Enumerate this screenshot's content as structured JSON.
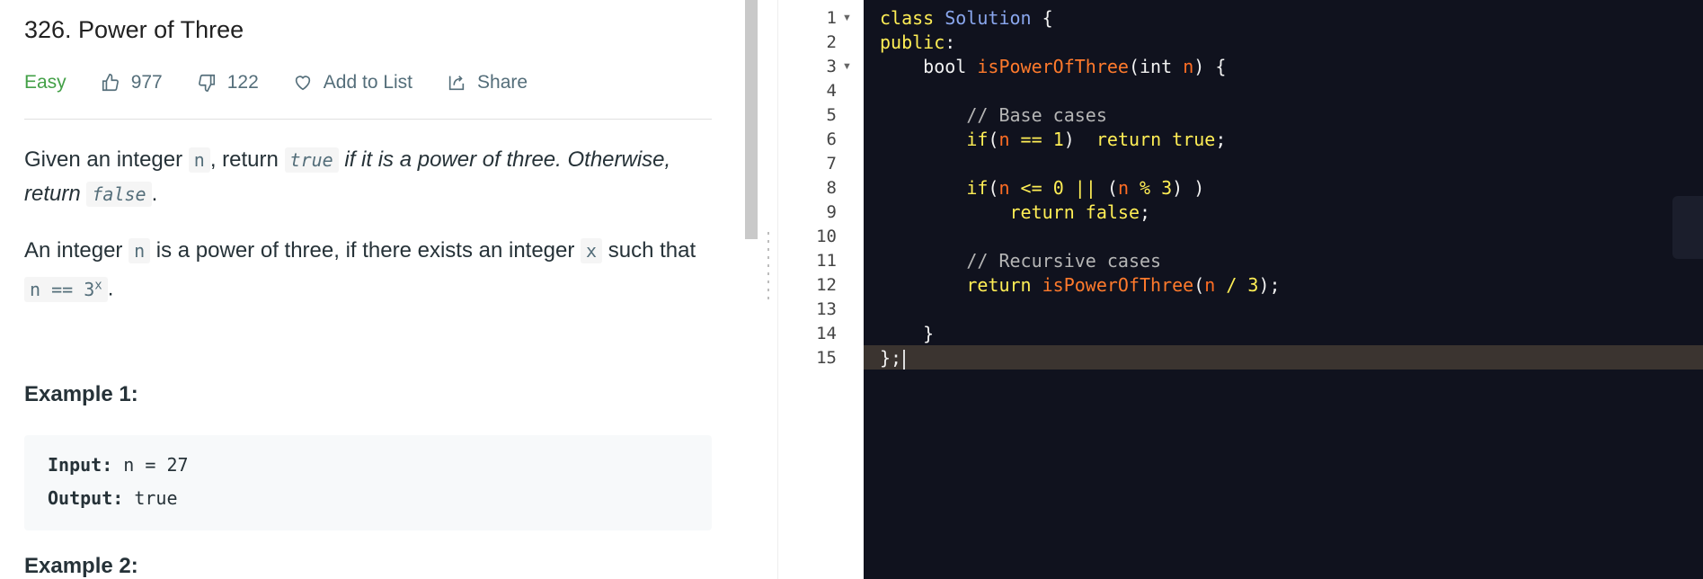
{
  "problem": {
    "title": "326. Power of Three",
    "difficulty": "Easy",
    "likes": "977",
    "dislikes": "122",
    "add_to_list": "Add to List",
    "share": "Share"
  },
  "description": {
    "p1": {
      "t1": "Given an integer ",
      "c1": "n",
      "t2": ", return ",
      "c2": "true",
      "t3": " ",
      "em1": "if it is a power of three. Otherwise, return ",
      "c3": "false",
      "t4": "."
    },
    "p2": {
      "t1": "An integer ",
      "c1": "n",
      "t2": " is a power of three, if there exists an integer ",
      "c2": "x",
      "t3": " such that ",
      "c3": "n == 3",
      "c3sup": "x",
      "t4": "."
    }
  },
  "examples": [
    {
      "heading": "Example 1:",
      "input_label": "Input:",
      "input_value": " n = 27",
      "output_label": "Output:",
      "output_value": " true"
    },
    {
      "heading": "Example 2:"
    }
  ],
  "editor": {
    "line_numbers": [
      "1",
      "2",
      "3",
      "4",
      "5",
      "6",
      "7",
      "8",
      "9",
      "10",
      "11",
      "12",
      "13",
      "14",
      "15"
    ],
    "code": {
      "l1": {
        "kw": "class",
        "sp": " ",
        "cls": "Solution",
        "rest": " {"
      },
      "l2": {
        "kw": "public",
        "rest": ":"
      },
      "l3": {
        "indent": "    ",
        "type": "bool",
        "sp": " ",
        "fn": "isPowerOfThree",
        "p1": "(int ",
        "var": "n",
        "p2": ") {"
      },
      "l5": {
        "indent": "        ",
        "cm": "// Base cases"
      },
      "l6": {
        "indent": "        ",
        "kw": "if",
        "p1": "(",
        "var": "n",
        "op": " == ",
        "num": "1",
        "p2": ")  ",
        "kw2": "return true",
        "p3": ";"
      },
      "l8": {
        "indent": "        ",
        "kw": "if",
        "p1": "(",
        "var": "n",
        "op": " <= ",
        "num": "0",
        "op2": " || ",
        "p2": "(",
        "var2": "n",
        "op3": " % ",
        "num2": "3",
        "p3": ") )"
      },
      "l9": {
        "indent": "            ",
        "kw": "return false",
        "p1": ";"
      },
      "l11": {
        "indent": "        ",
        "cm": "// Recursive cases"
      },
      "l12": {
        "indent": "        ",
        "kw": "return",
        "sp": " ",
        "fn": "isPowerOfThree",
        "p1": "(",
        "var": "n",
        "op": " / ",
        "num": "3",
        "p2": ");"
      },
      "l14": {
        "indent": "    ",
        "rest": "}"
      },
      "l15": {
        "rest": "};"
      }
    }
  }
}
